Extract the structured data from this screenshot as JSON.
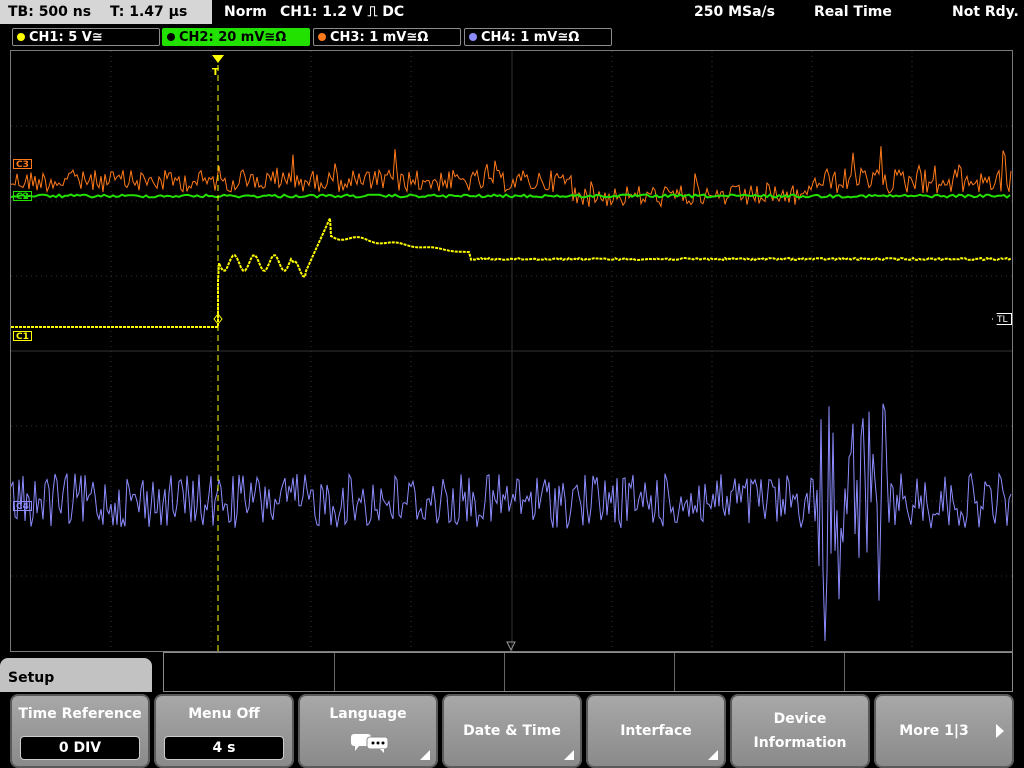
{
  "status": {
    "timebase": "TB: 500 ns",
    "trigger_time": "T: 1.47 µs",
    "mode": "Norm",
    "trigger": "CH1: 1.2 V ⎍ DC",
    "sample_rate": "250 MSa/s",
    "acq_mode": "Real Time",
    "state": "Not Rdy."
  },
  "channels": [
    {
      "label": "CH1: 5 V≅",
      "color": "#ffff00",
      "active": false
    },
    {
      "label": "CH2: 20 mV≅Ω",
      "color": "#22e000",
      "active": true
    },
    {
      "label": "CH3: 1 mV≅Ω",
      "color": "#ff7a1a",
      "active": false
    },
    {
      "label": "CH4: 1 mV≅Ω",
      "color": "#8c8cff",
      "active": false
    }
  ],
  "markers": {
    "c1": "C1",
    "c2": "C2",
    "c3": "C3",
    "c4": "C4",
    "tl": "TL",
    "t": "T"
  },
  "menu": {
    "title": "Setup",
    "keys": [
      {
        "label": "Time Reference",
        "value": "0 DIV"
      },
      {
        "label": "Menu Off",
        "value": "4 s"
      },
      {
        "label": "Language",
        "icon": "speech-bubbles-icon"
      },
      {
        "label": "Date & Time"
      },
      {
        "label": "Interface"
      },
      {
        "label": "Device Information"
      },
      {
        "label": "More 1|3"
      }
    ]
  }
}
